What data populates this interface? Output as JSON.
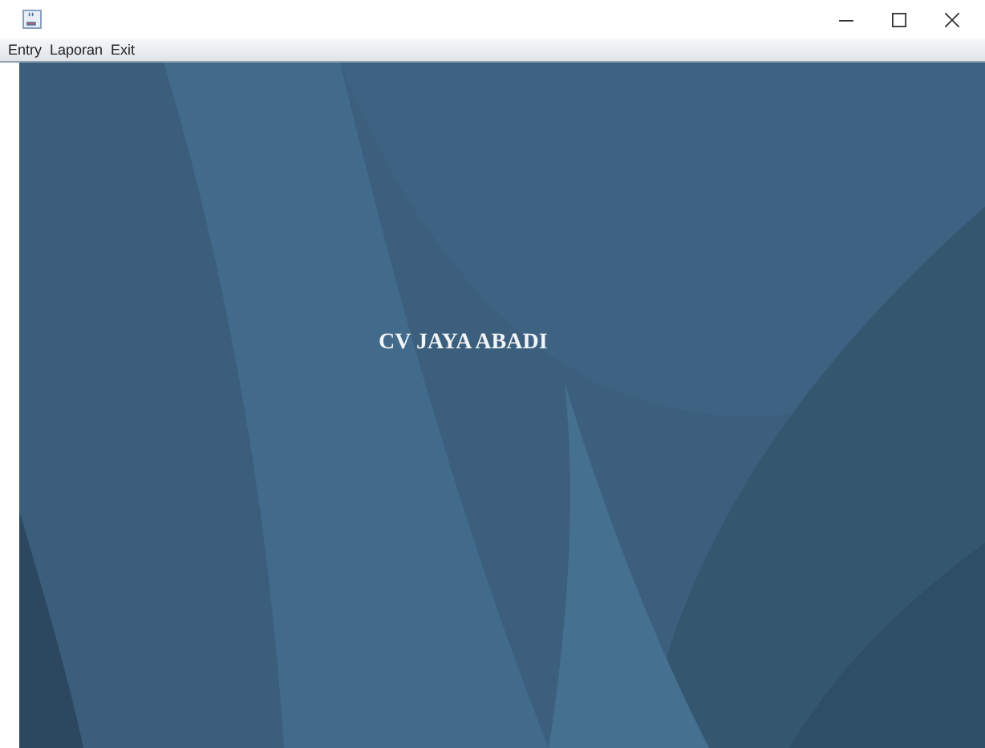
{
  "window": {
    "controls": [
      {
        "kind": "minimize"
      },
      {
        "kind": "maximize"
      },
      {
        "kind": "close"
      }
    ]
  },
  "menu": [
    {
      "label": "Entry"
    },
    {
      "label": "Laporan"
    },
    {
      "label": "Exit"
    }
  ],
  "desktop": {
    "label": "CV JAYA ABADI"
  }
}
